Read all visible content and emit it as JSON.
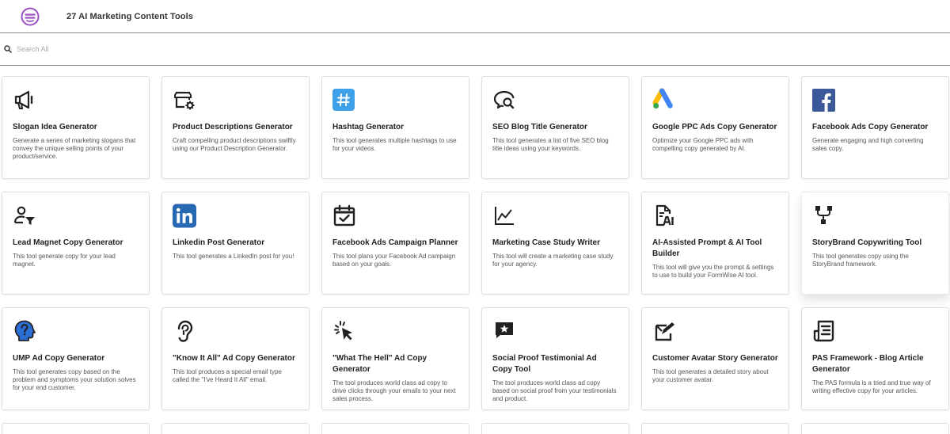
{
  "header": {
    "title": "27 AI Marketing Content Tools",
    "logo_icon": "formwise-logo-icon",
    "brand_color": "#9b4fc2"
  },
  "search": {
    "placeholder": "Search All",
    "icon": "search-icon"
  },
  "cards": [
    {
      "title": "Slogan Idea Generator",
      "desc": "Generate a series of marketing slogans that convey the unique selling points of your product/service.",
      "icon": "megaphone-icon"
    },
    {
      "title": "Product Descriptions Generator",
      "desc": "Craft compelling product descriptions swiftly using our Product Description Generator.",
      "icon": "store-gear-icon"
    },
    {
      "title": "Hashtag Generator",
      "desc": "This tool generates multiple hashtags to use for your videos.",
      "icon": "hashtag-icon"
    },
    {
      "title": "SEO Blog Title Generator",
      "desc": "This tool generates a list of five SEO blog title ideas using your keywords.",
      "icon": "search-chat-icon"
    },
    {
      "title": "Google PPC Ads Copy Generator",
      "desc": "Optimize your Google PPC ads with compelling copy generated by AI.",
      "icon": "google-ads-icon"
    },
    {
      "title": "Facebook Ads Copy Generator",
      "desc": "Generate engaging and high converting sales copy.",
      "icon": "facebook-icon"
    },
    {
      "title": "Lead Magnet Copy Generator",
      "desc": "This tool generate copy for your lead magnet.",
      "icon": "user-filter-icon"
    },
    {
      "title": "Linkedin Post Generator",
      "desc": "This tool generates a LinkedIn post for you!",
      "icon": "linkedin-icon"
    },
    {
      "title": "Facebook Ads Campaign Planner",
      "desc": "This tool plans your Facebook Ad campaign based on your goals.",
      "icon": "calendar-check-icon"
    },
    {
      "title": "Marketing Case Study Writer",
      "desc": "This tool will create a marketing case study for your agency.",
      "icon": "line-chart-icon"
    },
    {
      "title": "AI-Assisted Prompt & AI Tool Builder",
      "desc": "This tool will give you the prompt & settings to use to build your FormWise AI tool.",
      "icon": "ai-document-icon"
    },
    {
      "title": "StoryBrand Copywriting Tool",
      "desc": "This tool generates copy using the StoryBrand framework.",
      "icon": "flow-diagram-icon"
    },
    {
      "title": "UMP Ad Copy Generator",
      "desc": "This tool generates copy based on the problem and symptoms your solution solves for your end customer.",
      "icon": "head-question-icon"
    },
    {
      "title": "\"Know It All\" Ad Copy Generator",
      "desc": "This tool produces a special email type called the \"I've Heard It All\" email.",
      "icon": "ear-icon"
    },
    {
      "title": "\"What The Hell\" Ad Copy Generator",
      "desc": "The tool produces world class ad copy to drive clicks through your emails to your next sales process.",
      "icon": "cursor-click-icon"
    },
    {
      "title": "Social Proof Testimonial Ad Copy Tool",
      "desc": "The tool produces world class ad copy based on social proof from your testimonials and product.",
      "icon": "star-message-icon"
    },
    {
      "title": "Customer Avatar Story Generator",
      "desc": "This tool generates a detailed story about your customer avatar.",
      "icon": "edit-square-icon"
    },
    {
      "title": "PAS Framework - Blog Article Generator",
      "desc": "The PAS formula is a tried and true way of writing effective copy for your articles.",
      "icon": "article-icon"
    }
  ]
}
